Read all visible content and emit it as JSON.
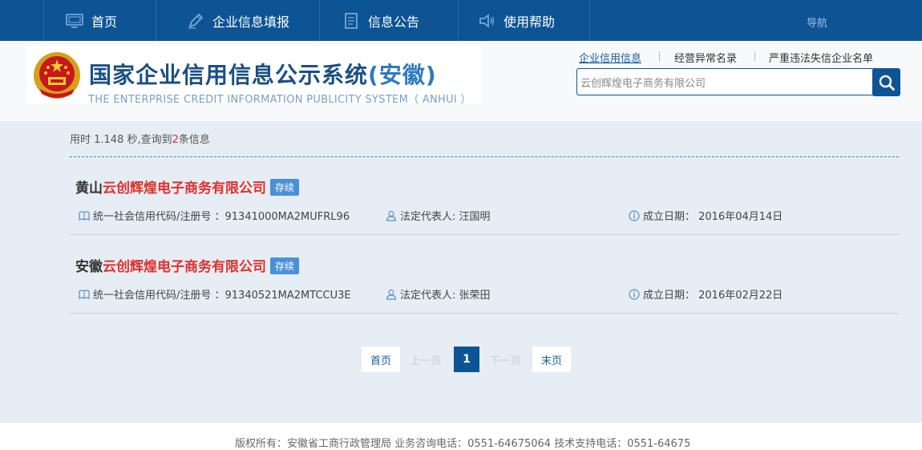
{
  "nav": {
    "items": [
      {
        "label": "首页",
        "icon": "monitor-icon"
      },
      {
        "label": "企业信息填报",
        "icon": "pen-icon"
      },
      {
        "label": "信息公告",
        "icon": "document-icon"
      },
      {
        "label": "使用帮助",
        "icon": "speaker-icon"
      }
    ],
    "guide": "导航"
  },
  "header": {
    "title_main": "国家企业信用信息公示系统",
    "title_province": "(安徽)",
    "subtitle_en": "THE ENTERPRISE CREDIT INFORMATION PUBLICITY SYSTEM（ ANHUI ）",
    "links": [
      "企业信用信息",
      "经营异常名录",
      "严重违法失信企业名单"
    ]
  },
  "search": {
    "value": "云创辉煌电子商务有限公司",
    "button_icon": "search-icon"
  },
  "stats": {
    "prefix": "用时 1.148 秒,查询到",
    "count": "2",
    "suffix": "条信息"
  },
  "results": [
    {
      "prefix": "黄山",
      "highlight": "云创辉煌电子商务有限公司",
      "status": "存续",
      "credit_code": "统一社会信用代码/注册号 ：91341000MA2MUFRL96",
      "legal_rep": "法定代表人: 汪国明",
      "est_date": "成立日期： 2016年04月14日"
    },
    {
      "prefix": "安徽",
      "highlight": "云创辉煌电子商务有限公司",
      "status": "存续",
      "credit_code": "统一社会信用代码/注册号 ：91340521MA2MTCCU3E",
      "legal_rep": "法定代表人: 张荣田",
      "est_date": "成立日期： 2016年02月22日"
    }
  ],
  "pagination": {
    "first": "首页",
    "prev": "上一页",
    "current": "1",
    "next": "下一页",
    "last": "末页"
  },
  "footer": {
    "text": "版权所有：安徽省工商行政管理局 业务咨询电话：0551-64675064 技术支持电话：0551-64675"
  }
}
